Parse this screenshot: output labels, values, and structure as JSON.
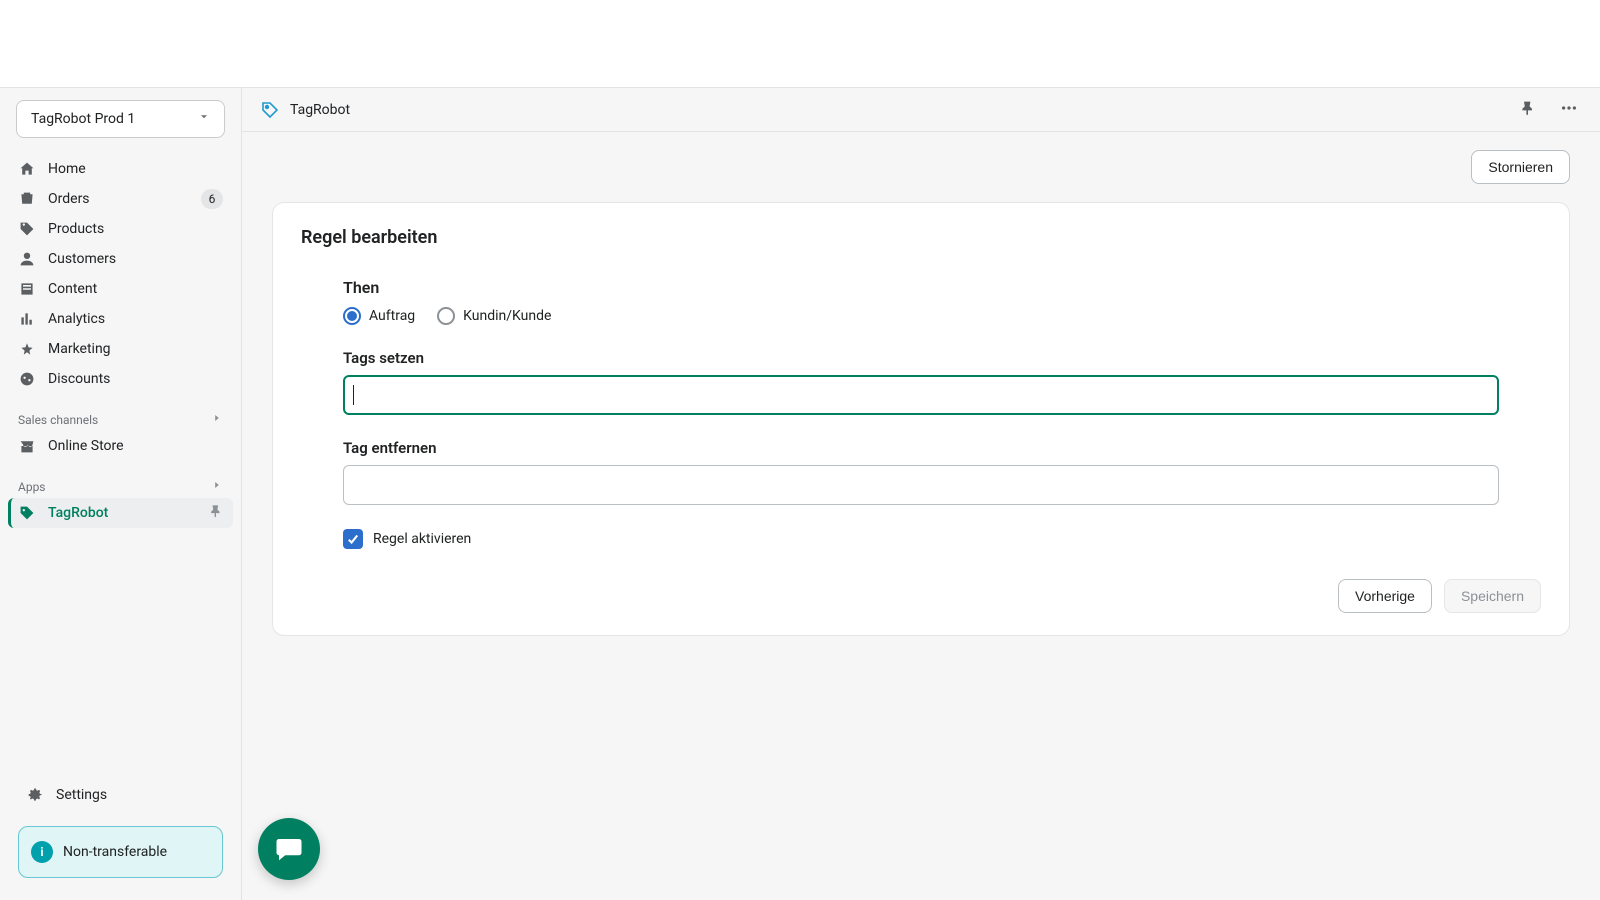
{
  "store": {
    "name": "TagRobot Prod 1"
  },
  "sidebar": {
    "items": [
      {
        "label": "Home"
      },
      {
        "label": "Orders",
        "badge": "6"
      },
      {
        "label": "Products"
      },
      {
        "label": "Customers"
      },
      {
        "label": "Content"
      },
      {
        "label": "Analytics"
      },
      {
        "label": "Marketing"
      },
      {
        "label": "Discounts"
      }
    ],
    "section_sales": "Sales channels",
    "online_store": "Online Store",
    "section_apps": "Apps",
    "app_tagrobot": "TagRobot",
    "settings": "Settings",
    "banner_text": "Non-transferable"
  },
  "topbar": {
    "app_title": "TagRobot"
  },
  "actions": {
    "cancel": "Stornieren",
    "previous": "Vorherige",
    "save": "Speichern"
  },
  "form": {
    "card_title": "Regel bearbeiten",
    "then_label": "Then",
    "radio_order": "Auftrag",
    "radio_customer": "Kundin/Kunde",
    "tags_set_label": "Tags setzen",
    "tags_set_value": "",
    "tag_remove_label": "Tag entfernen",
    "tag_remove_value": "",
    "activate_label": "Regel aktivieren"
  }
}
